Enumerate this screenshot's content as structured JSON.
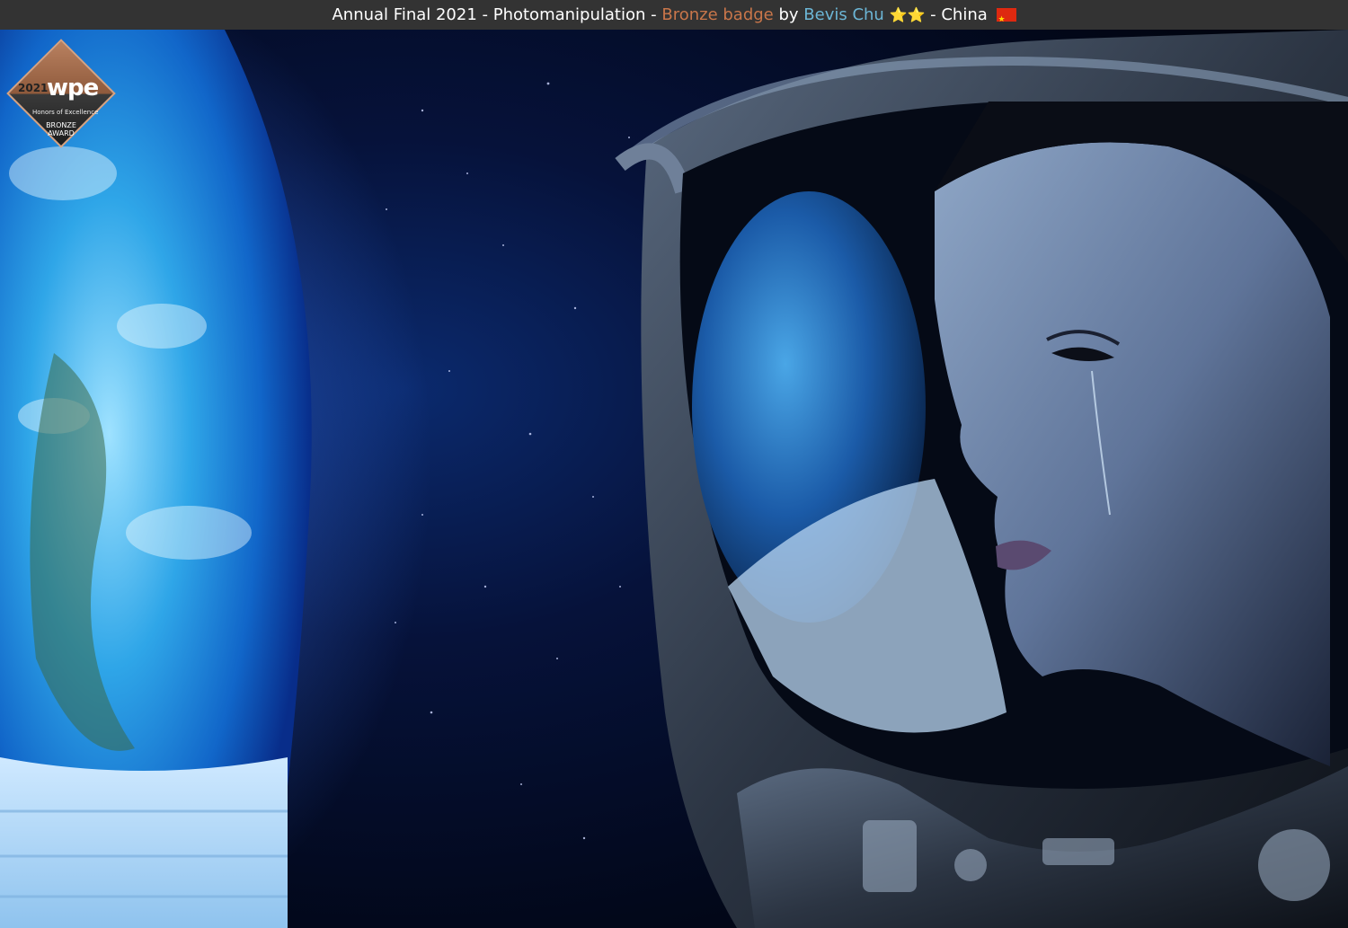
{
  "header": {
    "prefix": "Annual Final 2021 - Photomanipulation - ",
    "badge_label": "Bronze badge",
    "by_label": " by ",
    "author": "Bevis Chu",
    "stars": "⭐⭐",
    "country_sep": " - China ",
    "flag_icon": "china-flag-icon"
  },
  "award_badge": {
    "year": "2021",
    "brand": "wpe",
    "honors": "Honors of Excellence",
    "level": "BRONZE AWARD"
  },
  "colors": {
    "header_bg": "#333333",
    "badge_text": "#c9764a",
    "author_text": "#6cb6d6"
  }
}
